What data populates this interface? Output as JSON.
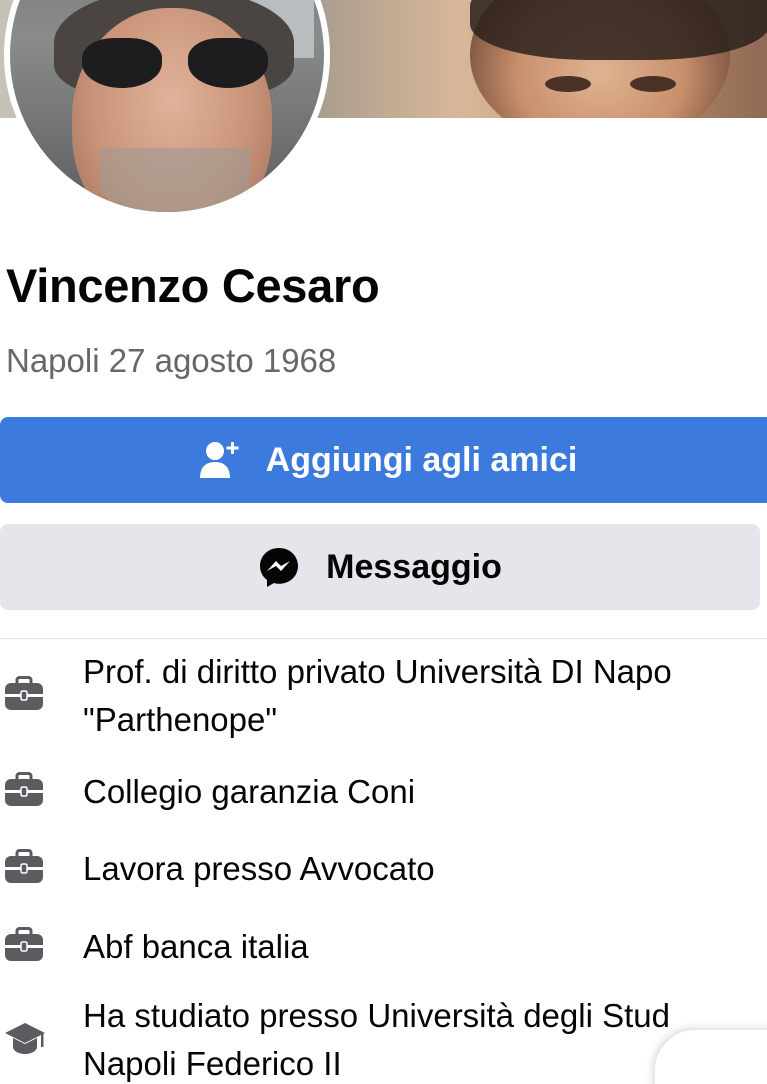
{
  "profile": {
    "name": "Vincenzo Cesaro",
    "subtitle": "Napoli 27 agosto 1968"
  },
  "actions": {
    "add_friend_label": "Aggiungi agli amici",
    "message_label": "Messaggio"
  },
  "info": [
    {
      "icon": "briefcase-icon",
      "line1": "Prof. di diritto privato Università DI Napo",
      "line2": "\"Parthenope\""
    },
    {
      "icon": "briefcase-icon",
      "line1": "Collegio garanzia Coni"
    },
    {
      "icon": "briefcase-icon",
      "line1": "Lavora presso Avvocato"
    },
    {
      "icon": "briefcase-icon",
      "line1": "Abf banca italia"
    },
    {
      "icon": "graduation-cap-icon",
      "line1": "Ha studiato presso Università degli Stud",
      "line2": "Napoli Federico II"
    }
  ],
  "colors": {
    "primary_button": "#3d7ade",
    "secondary_button": "#e4e6eb",
    "secondary_text": "#65676b"
  }
}
